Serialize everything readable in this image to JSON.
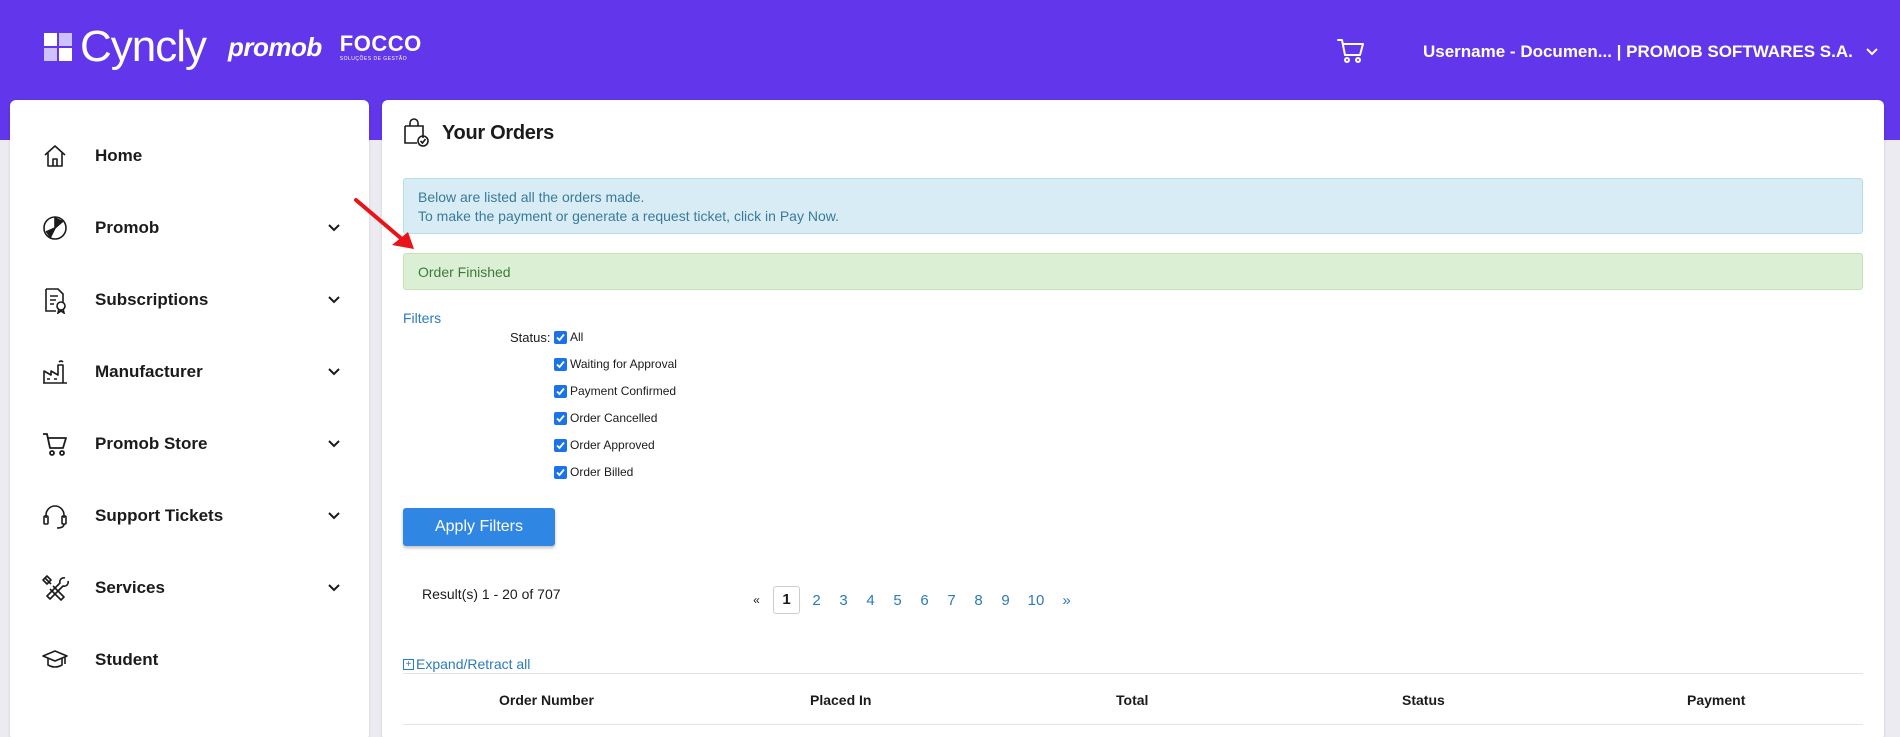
{
  "header": {
    "brand_cyncly": "Cyncly",
    "brand_promob": "promob",
    "brand_focco": "FOCCO",
    "brand_focco_sub": "SOLUÇÕES DE GESTÃO",
    "user_label": "Username - Documen... | PROMOB SOFTWARES S.A.",
    "accent": "#6236ea"
  },
  "sidebar": {
    "items": [
      {
        "label": "Home",
        "icon": "home-icon",
        "expandable": false
      },
      {
        "label": "Promob",
        "icon": "promob-icon",
        "expandable": true
      },
      {
        "label": "Subscriptions",
        "icon": "subscriptions-icon",
        "expandable": true
      },
      {
        "label": "Manufacturer",
        "icon": "factory-icon",
        "expandable": true
      },
      {
        "label": "Promob Store",
        "icon": "cart-icon",
        "expandable": true
      },
      {
        "label": "Support Tickets",
        "icon": "headset-icon",
        "expandable": true
      },
      {
        "label": "Services",
        "icon": "tools-icon",
        "expandable": true
      },
      {
        "label": "Student",
        "icon": "graduation-cap-icon",
        "expandable": false
      }
    ]
  },
  "main": {
    "title": "Your Orders",
    "info_line1": "Below are listed all the orders made.",
    "info_line2": "To make the payment or generate a request ticket, click in Pay Now.",
    "success_message": "Order Finished",
    "filters_link": "Filters",
    "status_label": "Status:",
    "status_options": [
      {
        "label": "All",
        "checked": true
      },
      {
        "label": "Waiting for Approval",
        "checked": true
      },
      {
        "label": "Payment Confirmed",
        "checked": true
      },
      {
        "label": "Order Cancelled",
        "checked": true
      },
      {
        "label": "Order Approved",
        "checked": true
      },
      {
        "label": "Order Billed",
        "checked": true
      }
    ],
    "apply_button": "Apply Filters",
    "results_text": "Result(s) 1 - 20 of 707",
    "pager": {
      "prev": "«",
      "next": "»",
      "current": "1",
      "pages": [
        "2",
        "3",
        "4",
        "5",
        "6",
        "7",
        "8",
        "9",
        "10"
      ]
    },
    "expand_link": "Expand/Retract all",
    "expand_box": "+",
    "table_headers": [
      "Order Number",
      "Placed In",
      "Total",
      "Status",
      "Payment"
    ]
  }
}
